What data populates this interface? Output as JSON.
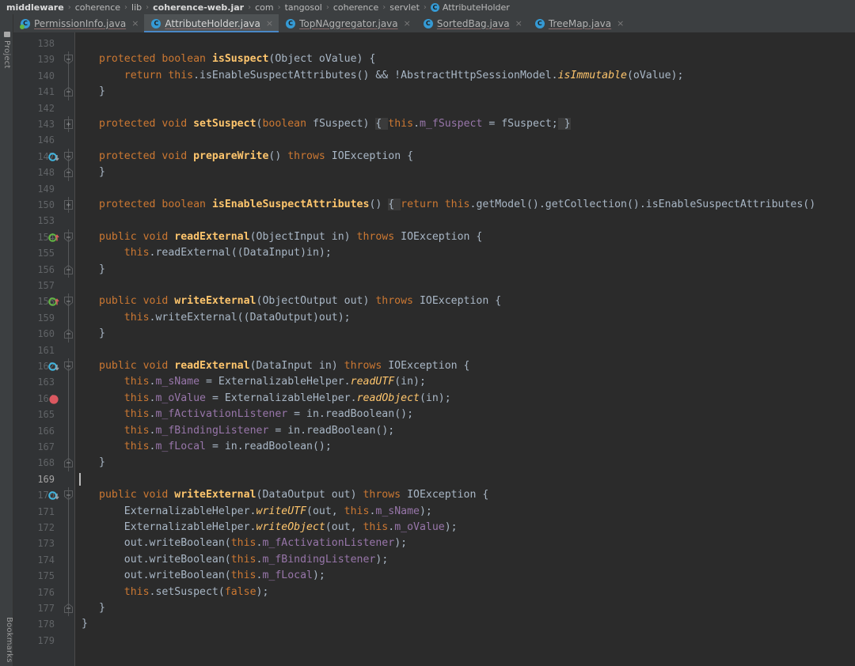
{
  "window": {
    "app": "IntelliJ IDEA",
    "theme_bg": "#2b2b2b",
    "accent": "#4a88c7"
  },
  "breadcrumb": {
    "name": "navigation-bar",
    "items": [
      {
        "label": "middleware",
        "bold": true,
        "icon": null
      },
      {
        "label": "coherence",
        "bold": false,
        "icon": null
      },
      {
        "label": "lib",
        "bold": false,
        "icon": null
      },
      {
        "label": "coherence-web.jar",
        "bold": true,
        "icon": null
      },
      {
        "label": "com",
        "bold": false,
        "icon": null
      },
      {
        "label": "tangosol",
        "bold": false,
        "icon": null
      },
      {
        "label": "coherence",
        "bold": false,
        "icon": null
      },
      {
        "label": "servlet",
        "bold": false,
        "icon": null
      },
      {
        "label": "AttributeHolder",
        "bold": false,
        "icon": "java-class-icon"
      }
    ],
    "separator": "›"
  },
  "tool_stripe": {
    "top_label": "Project",
    "bottom_label": "Bookmarks",
    "top_icon": "folder-icon"
  },
  "tabs": {
    "close_glyph": "×",
    "items": [
      {
        "label": "PermissionInfo.java",
        "icon": "java-class-icon",
        "modified": true,
        "active": false
      },
      {
        "label": "AttributeHolder.java",
        "icon": "java-class-icon",
        "modified": false,
        "active": true
      },
      {
        "label": "TopNAggregator.java",
        "icon": "java-class-icon",
        "modified": false,
        "active": false
      },
      {
        "label": "SortedBag.java",
        "icon": "java-class-icon",
        "modified": false,
        "active": false
      },
      {
        "label": "TreeMap.java",
        "icon": "java-class-icon",
        "modified": false,
        "active": false
      }
    ]
  },
  "editor": {
    "language": "java",
    "file": "AttributeHolder.java",
    "caret_line": 169,
    "breakpoint_line": 164,
    "lines": [
      {
        "num": "138",
        "fold": "none",
        "gicon": null,
        "hl": null,
        "tokens": []
      },
      {
        "num": "139",
        "fold": "open",
        "gicon": null,
        "hl": null,
        "tokens": [
          [
            "kw",
            "protected "
          ],
          [
            "kw",
            "boolean "
          ],
          [
            "fnb",
            "isSuspect"
          ],
          [
            "pl",
            "(Object oValue) {"
          ]
        ]
      },
      {
        "num": "140",
        "fold": "line",
        "gicon": null,
        "hl": null,
        "tokens": [
          [
            "pl",
            "    "
          ],
          [
            "kw",
            "return "
          ],
          [
            "thi",
            "this"
          ],
          [
            "pl",
            ".isEnableSuspectAttributes() && !AbstractHttpSessionModel."
          ],
          [
            "sm",
            "isImmutable"
          ],
          [
            "pl",
            "(oValue);"
          ]
        ]
      },
      {
        "num": "141",
        "fold": "close",
        "gicon": null,
        "hl": null,
        "tokens": [
          [
            "pl",
            "}"
          ]
        ]
      },
      {
        "num": "142",
        "fold": "none",
        "gicon": null,
        "hl": null,
        "tokens": []
      },
      {
        "num": "143",
        "fold": "plus",
        "gicon": null,
        "hl": null,
        "tokens": [
          [
            "kw",
            "protected "
          ],
          [
            "kw",
            "void "
          ],
          [
            "fnb",
            "setSuspect"
          ],
          [
            "pl",
            "("
          ],
          [
            "kw",
            "boolean "
          ],
          [
            "pl",
            "fSuspect) "
          ],
          [
            "br",
            "{ "
          ],
          [
            "thi",
            "this"
          ],
          [
            "pl",
            "."
          ],
          [
            "fld",
            "m_fSuspect"
          ],
          [
            "pl",
            " = fSuspect;"
          ],
          [
            "br",
            " }"
          ]
        ]
      },
      {
        "num": "146",
        "fold": "none",
        "gicon": null,
        "hl": null,
        "tokens": []
      },
      {
        "num": "147",
        "fold": "open",
        "gicon": "override-icon",
        "hl": null,
        "tokens": [
          [
            "kw",
            "protected "
          ],
          [
            "kw",
            "void "
          ],
          [
            "fnb",
            "prepareWrite"
          ],
          [
            "pl",
            "() "
          ],
          [
            "kw",
            "throws "
          ],
          [
            "pl",
            "IOException {"
          ]
        ]
      },
      {
        "num": "148",
        "fold": "close",
        "gicon": null,
        "hl": null,
        "tokens": [
          [
            "pl",
            "}"
          ]
        ]
      },
      {
        "num": "149",
        "fold": "none",
        "gicon": null,
        "hl": null,
        "tokens": []
      },
      {
        "num": "150",
        "fold": "plus",
        "gicon": null,
        "hl": null,
        "tokens": [
          [
            "kw",
            "protected "
          ],
          [
            "kw",
            "boolean "
          ],
          [
            "fnb",
            "isEnableSuspectAttributes"
          ],
          [
            "pl",
            "() "
          ],
          [
            "br",
            "{ "
          ],
          [
            "kw",
            "return "
          ],
          [
            "thi",
            "this"
          ],
          [
            "pl",
            ".getModel().getCollection().isEnableSuspectAttributes()"
          ]
        ]
      },
      {
        "num": "153",
        "fold": "none",
        "gicon": null,
        "hl": null,
        "tokens": []
      },
      {
        "num": "154",
        "fold": "open",
        "gicon": "implement-icon",
        "hl": null,
        "tokens": [
          [
            "kw",
            "public "
          ],
          [
            "kw",
            "void "
          ],
          [
            "fnb",
            "readExternal"
          ],
          [
            "pl",
            "(ObjectInput in) "
          ],
          [
            "kw",
            "throws "
          ],
          [
            "pl",
            "IOException {"
          ]
        ]
      },
      {
        "num": "155",
        "fold": "line",
        "gicon": null,
        "hl": null,
        "tokens": [
          [
            "pl",
            "    "
          ],
          [
            "thi",
            "this"
          ],
          [
            "pl",
            ".readExternal((DataInput)in);"
          ]
        ]
      },
      {
        "num": "156",
        "fold": "close",
        "gicon": null,
        "hl": null,
        "tokens": [
          [
            "pl",
            "}"
          ]
        ]
      },
      {
        "num": "157",
        "fold": "none",
        "gicon": null,
        "hl": null,
        "tokens": []
      },
      {
        "num": "158",
        "fold": "open",
        "gicon": "implement-icon",
        "hl": null,
        "tokens": [
          [
            "kw",
            "public "
          ],
          [
            "kw",
            "void "
          ],
          [
            "fnb",
            "writeExternal"
          ],
          [
            "pl",
            "(ObjectOutput out) "
          ],
          [
            "kw",
            "throws "
          ],
          [
            "pl",
            "IOException {"
          ]
        ]
      },
      {
        "num": "159",
        "fold": "line",
        "gicon": null,
        "hl": null,
        "tokens": [
          [
            "pl",
            "    "
          ],
          [
            "thi",
            "this"
          ],
          [
            "pl",
            ".writeExternal((DataOutput)out);"
          ]
        ]
      },
      {
        "num": "160",
        "fold": "close",
        "gicon": null,
        "hl": null,
        "tokens": [
          [
            "pl",
            "}"
          ]
        ]
      },
      {
        "num": "161",
        "fold": "none",
        "gicon": null,
        "hl": null,
        "tokens": []
      },
      {
        "num": "162",
        "fold": "open",
        "gicon": "override-icon",
        "hl": null,
        "tokens": [
          [
            "kw",
            "public "
          ],
          [
            "kw",
            "void "
          ],
          [
            "fnb",
            "readExternal"
          ],
          [
            "pl",
            "(DataInput in) "
          ],
          [
            "kw",
            "throws "
          ],
          [
            "pl",
            "IOException {"
          ]
        ]
      },
      {
        "num": "163",
        "fold": "line",
        "gicon": null,
        "hl": null,
        "tokens": [
          [
            "pl",
            "    "
          ],
          [
            "thi",
            "this"
          ],
          [
            "pl",
            "."
          ],
          [
            "fld",
            "m_sName"
          ],
          [
            "pl",
            " = ExternalizableHelper."
          ],
          [
            "sm",
            "readUTF"
          ],
          [
            "pl",
            "(in);"
          ]
        ]
      },
      {
        "num": "164",
        "fold": "line",
        "gicon": "breakpoint-icon",
        "hl": "bp",
        "tokens": [
          [
            "pl",
            "    "
          ],
          [
            "thi",
            "this"
          ],
          [
            "pl",
            "."
          ],
          [
            "fld",
            "m_oValue"
          ],
          [
            "pl",
            " = ExternalizableHelper."
          ],
          [
            "sm",
            "readObject"
          ],
          [
            "pl",
            "(in);"
          ]
        ]
      },
      {
        "num": "165",
        "fold": "line",
        "gicon": null,
        "hl": null,
        "tokens": [
          [
            "pl",
            "    "
          ],
          [
            "thi",
            "this"
          ],
          [
            "pl",
            "."
          ],
          [
            "fld",
            "m_fActivationListener"
          ],
          [
            "pl",
            " = in.readBoolean();"
          ]
        ]
      },
      {
        "num": "166",
        "fold": "line",
        "gicon": null,
        "hl": null,
        "tokens": [
          [
            "pl",
            "    "
          ],
          [
            "thi",
            "this"
          ],
          [
            "pl",
            "."
          ],
          [
            "fld",
            "m_fBindingListener"
          ],
          [
            "pl",
            " = in.readBoolean();"
          ]
        ]
      },
      {
        "num": "167",
        "fold": "line",
        "gicon": null,
        "hl": null,
        "tokens": [
          [
            "pl",
            "    "
          ],
          [
            "thi",
            "this"
          ],
          [
            "pl",
            "."
          ],
          [
            "fld",
            "m_fLocal"
          ],
          [
            "pl",
            " = in.readBoolean();"
          ]
        ]
      },
      {
        "num": "168",
        "fold": "close",
        "gicon": null,
        "hl": null,
        "tokens": [
          [
            "pl",
            "}"
          ]
        ]
      },
      {
        "num": "169",
        "fold": "none",
        "gicon": null,
        "hl": "cur",
        "tokens": [],
        "caret": true
      },
      {
        "num": "170",
        "fold": "open",
        "gicon": "override-icon",
        "hl": null,
        "tokens": [
          [
            "kw",
            "public "
          ],
          [
            "kw",
            "void "
          ],
          [
            "fnb",
            "writeExternal"
          ],
          [
            "pl",
            "(DataOutput out) "
          ],
          [
            "kw",
            "throws "
          ],
          [
            "pl",
            "IOException {"
          ]
        ]
      },
      {
        "num": "171",
        "fold": "line",
        "gicon": null,
        "hl": null,
        "tokens": [
          [
            "pl",
            "    ExternalizableHelper."
          ],
          [
            "sm",
            "writeUTF"
          ],
          [
            "pl",
            "(out, "
          ],
          [
            "thi",
            "this"
          ],
          [
            "pl",
            "."
          ],
          [
            "fld",
            "m_sName"
          ],
          [
            "pl",
            ");"
          ]
        ]
      },
      {
        "num": "172",
        "fold": "line",
        "gicon": null,
        "hl": null,
        "tokens": [
          [
            "pl",
            "    ExternalizableHelper."
          ],
          [
            "sm",
            "writeObject"
          ],
          [
            "pl",
            "(out, "
          ],
          [
            "thi",
            "this"
          ],
          [
            "pl",
            "."
          ],
          [
            "fld",
            "m_oValue"
          ],
          [
            "pl",
            ");"
          ]
        ]
      },
      {
        "num": "173",
        "fold": "line",
        "gicon": null,
        "hl": null,
        "tokens": [
          [
            "pl",
            "    out.writeBoolean("
          ],
          [
            "thi",
            "this"
          ],
          [
            "pl",
            "."
          ],
          [
            "fld",
            "m_fActivationListener"
          ],
          [
            "pl",
            ");"
          ]
        ]
      },
      {
        "num": "174",
        "fold": "line",
        "gicon": null,
        "hl": null,
        "tokens": [
          [
            "pl",
            "    out.writeBoolean("
          ],
          [
            "thi",
            "this"
          ],
          [
            "pl",
            "."
          ],
          [
            "fld",
            "m_fBindingListener"
          ],
          [
            "pl",
            ");"
          ]
        ]
      },
      {
        "num": "175",
        "fold": "line",
        "gicon": null,
        "hl": null,
        "tokens": [
          [
            "pl",
            "    out.writeBoolean("
          ],
          [
            "thi",
            "this"
          ],
          [
            "pl",
            "."
          ],
          [
            "fld",
            "m_fLocal"
          ],
          [
            "pl",
            ");"
          ]
        ]
      },
      {
        "num": "176",
        "fold": "line",
        "gicon": null,
        "hl": null,
        "tokens": [
          [
            "pl",
            "    "
          ],
          [
            "thi",
            "this"
          ],
          [
            "pl",
            ".setSuspect("
          ],
          [
            "kw",
            "false"
          ],
          [
            "pl",
            ");"
          ]
        ]
      },
      {
        "num": "177",
        "fold": "close",
        "gicon": null,
        "hl": null,
        "tokens": [
          [
            "pl",
            "}"
          ]
        ]
      },
      {
        "num": "178",
        "fold": "none",
        "gicon": null,
        "hl": null,
        "tokens": [
          [
            "pl",
            "}"
          ],
          [
            "indent",
            "-1"
          ]
        ]
      },
      {
        "num": "179",
        "fold": "none",
        "gicon": null,
        "hl": null,
        "tokens": []
      }
    ]
  }
}
